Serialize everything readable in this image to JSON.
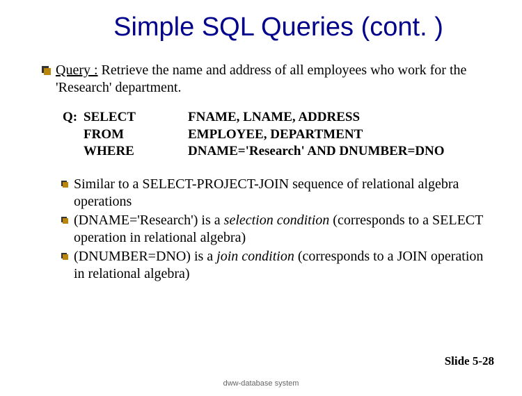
{
  "title": "Simple SQL Queries (cont. )",
  "query": {
    "label": "Query :",
    "text": " Retrieve the name and address of all employees who work for the 'Research' department."
  },
  "code": {
    "q": "Q:",
    "select": {
      "kw": "SELECT",
      "val": "FNAME, LNAME, ADDRESS"
    },
    "from": {
      "kw": "FROM",
      "val": "EMPLOYEE, DEPARTMENT"
    },
    "where": {
      "kw": "WHERE",
      "val": "DNAME='Research' AND DNUMBER=DNO"
    }
  },
  "subs": [
    {
      "pre": "Similar to a SELECT-PROJECT-JOIN sequence of relational algebra operations",
      "em": "",
      "post": ""
    },
    {
      "pre": "(DNAME='Research') is a ",
      "em": "selection condition",
      "post": "  (corresponds to a SELECT operation in relational algebra)"
    },
    {
      "pre": "(DNUMBER=DNO) is a ",
      "em": "join condition",
      "post": " (corresponds to a JOIN operation in relational algebra)"
    }
  ],
  "slide_num": "Slide 5-28",
  "footer": "dww-database system"
}
